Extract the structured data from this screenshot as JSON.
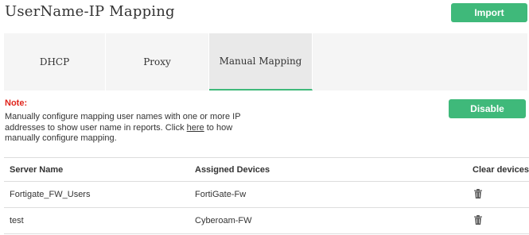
{
  "header": {
    "title": "UserName-IP Mapping",
    "import_label": "Import"
  },
  "tabs": [
    {
      "label": "DHCP",
      "active": false
    },
    {
      "label": "Proxy",
      "active": false
    },
    {
      "label": "Manual Mapping",
      "active": true
    }
  ],
  "note": {
    "label": "Note:",
    "text_before": "Manually configure mapping user names with one or more IP addresses to show user name in reports. Click ",
    "link_text": "here",
    "text_after": " to how manually configure mapping."
  },
  "disable_label": "Disable",
  "table": {
    "columns": [
      "Server Name",
      "Assigned Devices",
      "Clear devices"
    ],
    "rows": [
      {
        "server_name": "Fortigate_FW_Users",
        "assigned_devices": "FortiGate-Fw",
        "clear_icon": "trash-icon"
      },
      {
        "server_name": "test",
        "assigned_devices": "Cyberoam-FW",
        "clear_icon": "trash-icon"
      }
    ]
  },
  "colors": {
    "accent_green": "#3fb97a",
    "note_red": "#e0241b"
  }
}
